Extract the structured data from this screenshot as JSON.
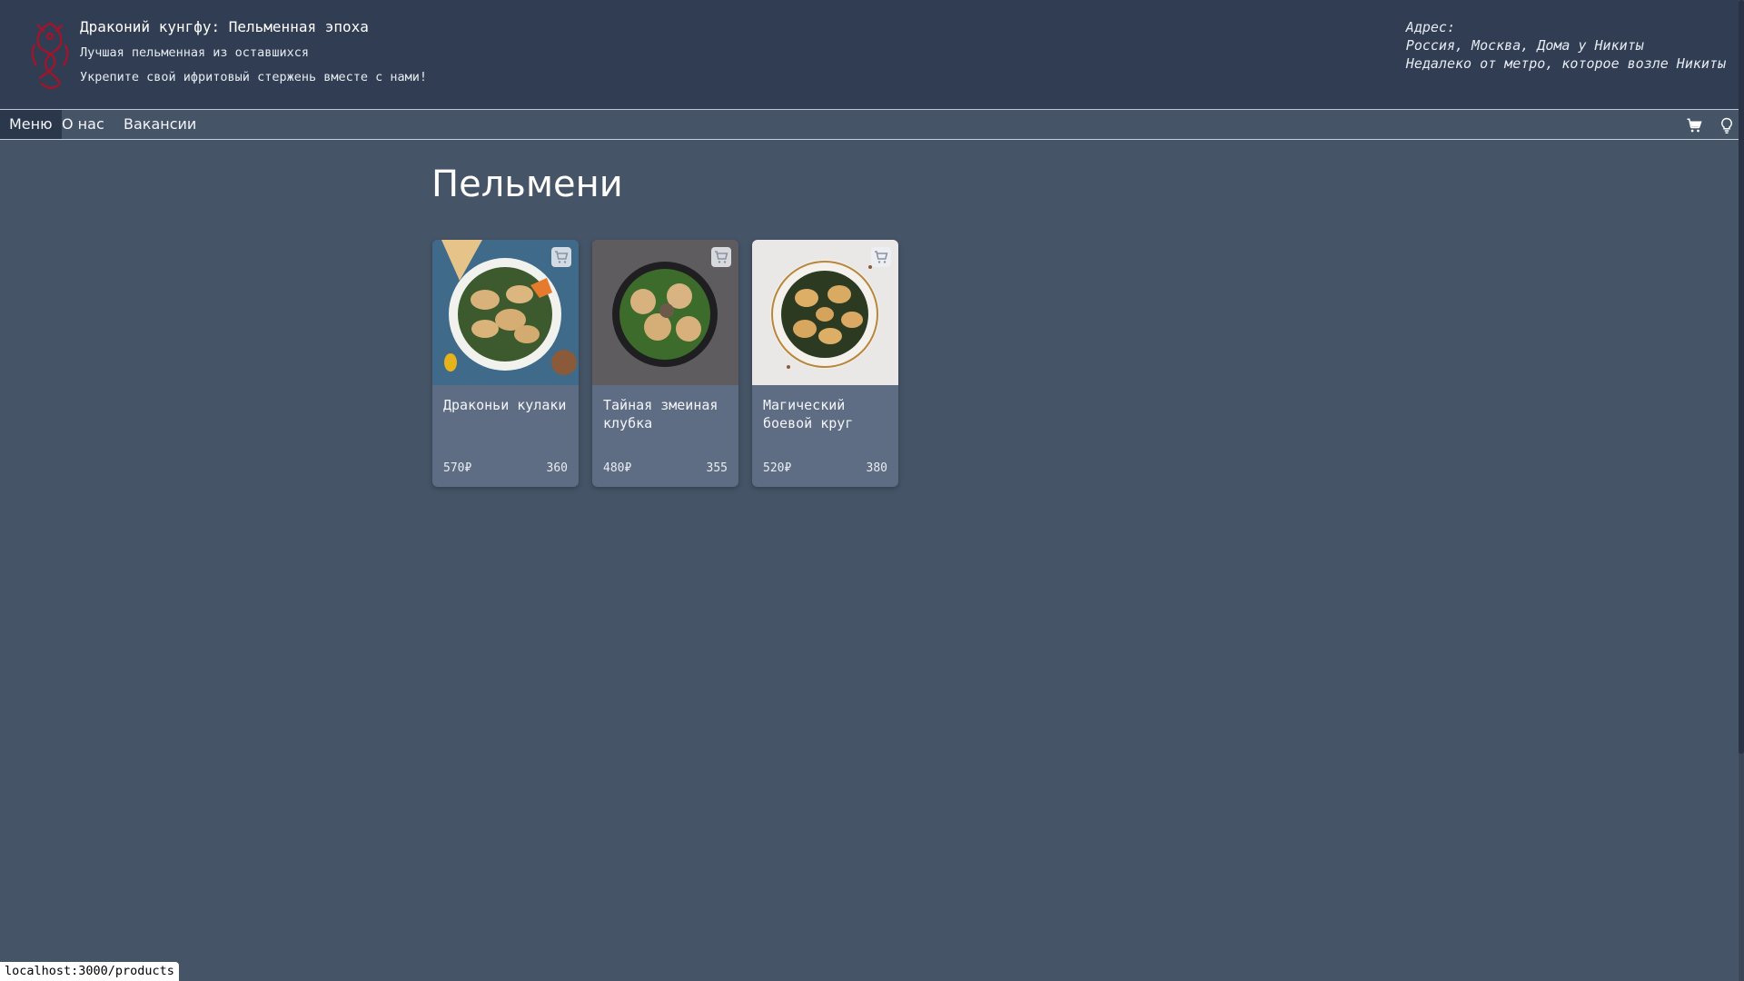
{
  "header": {
    "title": "Драконий кунгфу: Пельменная эпоха",
    "subtitle1": "Лучшая пельменная из оставшихся",
    "subtitle2": "Укрепите свой ифритовый стержень вместе с нами!",
    "logo_icon": "dragon-logo",
    "address": {
      "label": "Адрес:",
      "line1": "Россия, Москва, Дома у Никиты",
      "line2": "Недалеко от метро, которое возле Никиты"
    }
  },
  "nav": {
    "items": [
      {
        "label": "Меню",
        "active": true
      },
      {
        "label": "О нас",
        "active": false
      },
      {
        "label": "Вакансии",
        "active": false
      }
    ],
    "cart_icon": "cart-icon",
    "theme_icon": "lightbulb-icon"
  },
  "main": {
    "title": "Пельмени",
    "products": [
      {
        "name": "Драконьи кулаки",
        "price": "570₽",
        "weight": "360"
      },
      {
        "name": "Тайная змеиная клубка",
        "price": "480₽",
        "weight": "355"
      },
      {
        "name": "Магический боевой круг",
        "price": "520₽",
        "weight": "380"
      }
    ]
  },
  "status_url": "localhost:3000/products",
  "colors": {
    "header_bg": "#303d52",
    "page_bg": "#465468",
    "card_bg": "#5f6d84",
    "logo_red": "#a1152c"
  }
}
